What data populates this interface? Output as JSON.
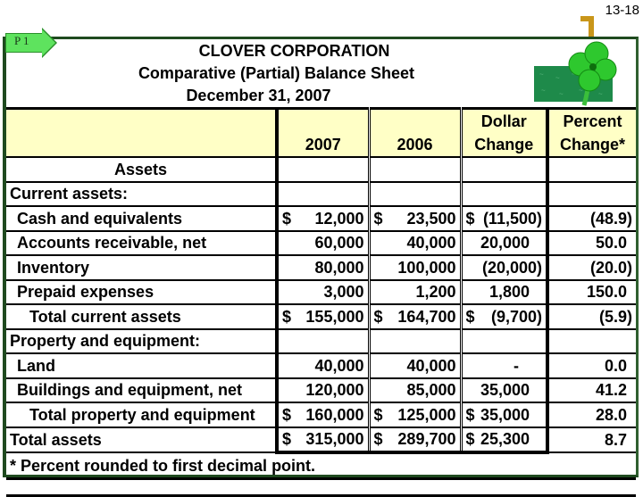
{
  "page_number": "13-18",
  "badge": {
    "label": "P 1"
  },
  "title": {
    "company": "CLOVER CORPORATION",
    "statement": "Comparative (Partial) Balance Sheet",
    "date": "December 31, 2007"
  },
  "icons": {
    "logo": "four-leaf-clover"
  },
  "colors": {
    "header_fill": "#ffffc6",
    "frame": "#1f4a1f",
    "badge": "#5ee35e",
    "bracket": "#c9961a",
    "clover": "#2ec82e",
    "clover_bg": "#1e8a4a"
  },
  "columns": {
    "c2007": "2007",
    "c2006": "2006",
    "dollar_line1": "Dollar",
    "dollar_line2": "Change",
    "percent_line1": "Percent",
    "percent_line2": "Change*"
  },
  "rows": [
    {
      "label": "Assets",
      "type": "section",
      "v2007": "",
      "v2006": "",
      "dollar": "",
      "pct": ""
    },
    {
      "label": "Current assets:",
      "type": "group",
      "v2007": "",
      "v2006": "",
      "dollar": "",
      "pct": ""
    },
    {
      "label": "Cash and equivalents",
      "type": "item",
      "cur": "$",
      "v2007": "12,000",
      "cur2006": "$",
      "v2006": "23,500",
      "cur_d": "$",
      "dollar": "(11,500)",
      "pct": "(48.9)"
    },
    {
      "label": "Accounts receivable, net",
      "type": "item",
      "v2007": "60,000",
      "v2006": "40,000",
      "dollar": "20,000",
      "pct": "50.0"
    },
    {
      "label": "Inventory",
      "type": "item",
      "v2007": "80,000",
      "v2006": "100,000",
      "dollar": "(20,000)",
      "pct": "(20.0)"
    },
    {
      "label": "Prepaid expenses",
      "type": "item",
      "v2007": "3,000",
      "v2006": "1,200",
      "dollar": "1,800",
      "pct": "150.0"
    },
    {
      "label": "Total current assets",
      "type": "total",
      "cur": "$",
      "v2007": "155,000",
      "cur2006": "$",
      "v2006": "164,700",
      "cur_d": "$",
      "dollar": "(9,700)",
      "pct": "(5.9)"
    },
    {
      "label": "Property and equipment:",
      "type": "group",
      "v2007": "",
      "v2006": "",
      "dollar": "",
      "pct": ""
    },
    {
      "label": "Land",
      "type": "item",
      "v2007": "40,000",
      "v2006": "40,000",
      "dollar": "-",
      "pct": "0.0"
    },
    {
      "label": "Buildings and equipment, net",
      "type": "item",
      "v2007": "120,000",
      "v2006": "85,000",
      "dollar": "35,000",
      "pct": "41.2"
    },
    {
      "label": "Total property and equipment",
      "type": "total",
      "cur": "$",
      "v2007": "160,000",
      "cur2006": "$",
      "v2006": "125,000",
      "cur_d": "$",
      "dollar": "35,000",
      "pct": "28.0"
    },
    {
      "label": "Total assets",
      "type": "grand",
      "cur": "$",
      "v2007": "315,000",
      "cur2006": "$",
      "v2006": "289,700",
      "cur_d": "$",
      "dollar": "25,300",
      "pct": "8.7"
    }
  ],
  "footnote": "* Percent rounded to first decimal point."
}
